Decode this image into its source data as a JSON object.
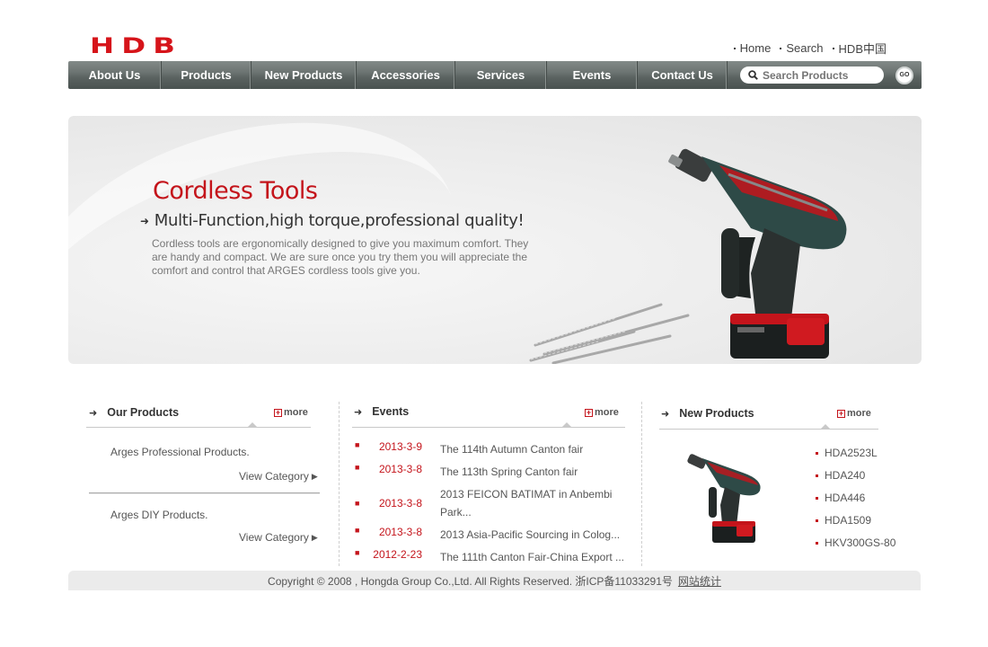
{
  "brand": {
    "logo_text": "HDB",
    "color": "#d6141a"
  },
  "top_links": [
    "Home",
    "Search",
    "HDB中国"
  ],
  "nav": {
    "items": [
      "About Us",
      "Products",
      "New Products",
      "Accessories",
      "Services",
      "Events",
      "Contact Us"
    ],
    "search_placeholder": "Search Products",
    "go_label": "GO"
  },
  "banner": {
    "title": "Cordless Tools",
    "subtitle": "Multi-Function,high torque,professional quality!",
    "description": "Cordless  tools are ergonomically designed to give you maximum comfort. They are handy and compact. We are sure once you try them you will appreciate the comfort and control that ARGES cordless tools give you."
  },
  "our_products": {
    "heading": "Our Products",
    "more": "more",
    "items": [
      {
        "name": "Arges Professional Products.",
        "link": "View Category"
      },
      {
        "name": "Arges DIY Products.",
        "link": "View Category"
      }
    ]
  },
  "events": {
    "heading": "Events",
    "more": "more",
    "items": [
      {
        "date": "2013-3-9",
        "title": "The 114th Autumn Canton fair"
      },
      {
        "date": "2013-3-8",
        "title": "The 113th Spring Canton fair"
      },
      {
        "date": "2013-3-8",
        "title": "2013 FEICON BATIMAT in Anbembi Park..."
      },
      {
        "date": "2013-3-8",
        "title": "2013 Asia-Pacific Sourcing in Colog..."
      },
      {
        "date": "2012-2-23",
        "title": "The 111th Canton Fair-China Export ..."
      }
    ]
  },
  "new_products": {
    "heading": "New Products",
    "more": "more",
    "items": [
      "HDA2523L",
      "HDA240",
      "HDA446",
      "HDA1509",
      "HKV300GS-80"
    ]
  },
  "footer": {
    "copyright": "Copyright © 2008 ,  Hongda Group Co.,Ltd.   All Rights Reserved.  浙ICP备11033291号",
    "stats_link": "网站统计"
  },
  "colors": {
    "accent_red": "#c4141b",
    "nav_gray": "#5a6260",
    "drill_green": "#2e4a47"
  }
}
